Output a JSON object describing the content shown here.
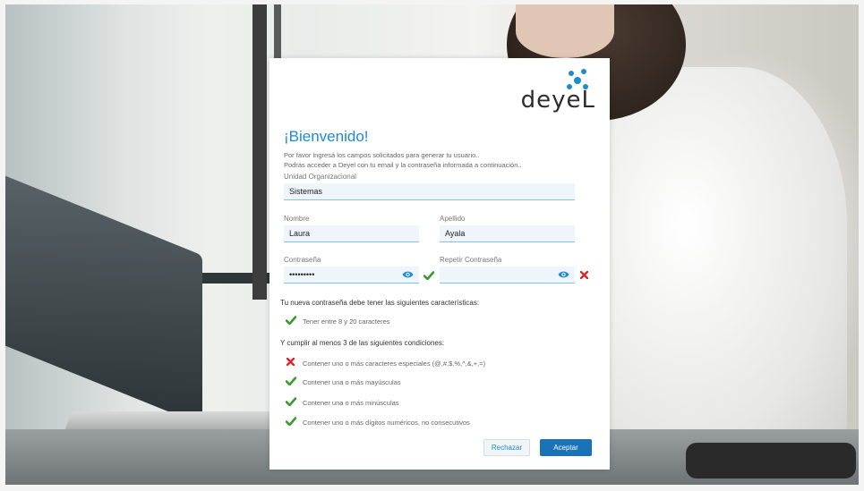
{
  "brand": {
    "logo_text": "deyeL"
  },
  "form": {
    "title": "¡Bienvenido!",
    "intro_line1": "Por favor ingresá los campos solicitados para generar tu usuario..",
    "intro_line2": "Podrás acceder a Deyel con tu email y la contraseña informada a continuación..",
    "org_unit": {
      "label": "Unidad Organizacional",
      "value": "Sistemas"
    },
    "first_name": {
      "label": "Nombre",
      "value": "Laura"
    },
    "last_name": {
      "label": "Apellido",
      "value": "Ayala"
    },
    "password": {
      "label": "Contraseña",
      "value": "•••••••••",
      "status": "valid"
    },
    "repeat_password": {
      "label": "Repetir Contraseña",
      "value": "",
      "status": "invalid"
    }
  },
  "requirements": {
    "heading": "Tu nueva contraseña debe tener las siguientes características:",
    "items": [
      {
        "text": "Tener entre 8 y 20 caracteres",
        "met": true
      }
    ],
    "conditions_heading": "Y cumplir al menos 3 de las siguientes condiciones:",
    "conditions": [
      {
        "text": "Contener uno o más caracteres especiales (@,#,$,%,^,&,+,=)",
        "met": false
      },
      {
        "text": "Contener una o más mayúsculas",
        "met": true
      },
      {
        "text": "Contener una o más minúsculas",
        "met": true
      },
      {
        "text": "Contener uno o más dígitos numéricos, no consecutivos",
        "met": true
      }
    ]
  },
  "buttons": {
    "reject": "Rechazar",
    "accept": "Aceptar"
  },
  "colors": {
    "accent": "#1e8bd1",
    "primary_button": "#1a72b8",
    "check": "#3a9a2e",
    "cross": "#d9262b"
  }
}
